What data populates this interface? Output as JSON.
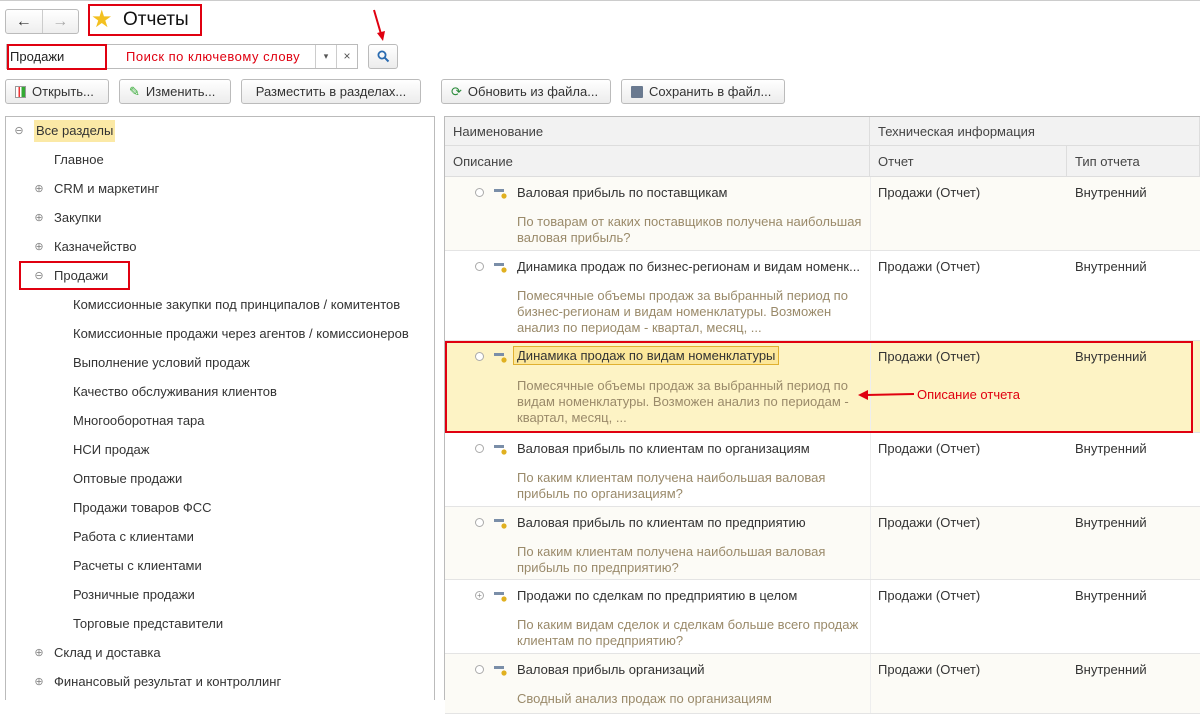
{
  "header": {
    "title": "Отчеты",
    "back": "←",
    "forward": "→"
  },
  "search": {
    "value": "Продажи",
    "hint": "Поиск по ключевому слову",
    "clear": "×"
  },
  "toolbar": {
    "open": "Открыть...",
    "edit": "Изменить...",
    "place": "Разместить в разделах...",
    "update": "Обновить из файла...",
    "save": "Сохранить в файл..."
  },
  "tree": [
    {
      "label": "Все разделы",
      "level": 0,
      "toggle": "⊖"
    },
    {
      "label": "Главное",
      "level": 1,
      "toggle": ""
    },
    {
      "label": "CRM и маркетинг",
      "level": 1,
      "toggle": "⊕"
    },
    {
      "label": "Закупки",
      "level": 1,
      "toggle": "⊕"
    },
    {
      "label": "Казначейство",
      "level": 1,
      "toggle": "⊕"
    },
    {
      "label": "Продажи",
      "level": 1,
      "toggle": "⊖"
    },
    {
      "label": "Комиссионные закупки под принципалов / комитентов",
      "level": 2,
      "toggle": ""
    },
    {
      "label": "Комиссионные продажи через агентов / комиссионеров",
      "level": 2,
      "toggle": ""
    },
    {
      "label": "Выполнение условий продаж",
      "level": 2,
      "toggle": ""
    },
    {
      "label": "Качество обслуживания клиентов",
      "level": 2,
      "toggle": ""
    },
    {
      "label": "Многооборотная тара",
      "level": 2,
      "toggle": ""
    },
    {
      "label": "НСИ продаж",
      "level": 2,
      "toggle": ""
    },
    {
      "label": "Оптовые продажи",
      "level": 2,
      "toggle": ""
    },
    {
      "label": "Продажи товаров ФСС",
      "level": 2,
      "toggle": ""
    },
    {
      "label": "Работа с клиентами",
      "level": 2,
      "toggle": ""
    },
    {
      "label": "Расчеты с клиентами",
      "level": 2,
      "toggle": ""
    },
    {
      "label": "Розничные продажи",
      "level": 2,
      "toggle": ""
    },
    {
      "label": "Торговые представители",
      "level": 2,
      "toggle": ""
    },
    {
      "label": "Склад и доставка",
      "level": 1,
      "toggle": "⊕"
    },
    {
      "label": "Финансовый результат и контроллинг",
      "level": 1,
      "toggle": "⊕"
    }
  ],
  "columns": {
    "name": "Наименование",
    "tech": "Техническая информация",
    "desc": "Описание",
    "report": "Отчет",
    "type": "Тип отчета"
  },
  "rows": [
    {
      "name": "Валовая прибыль по поставщикам",
      "desc": "По товарам от каких поставщиков получена наибольшая валовая прибыль?",
      "report": "Продажи (Отчет)",
      "type": "Внутренний",
      "toggle": ""
    },
    {
      "name": "Динамика продаж по бизнес-регионам и видам номенк...",
      "desc": "Помесячные объемы продаж за выбранный период по бизнес-регионам и видам номенклатуры. Возможен анализ по периодам - квартал, месяц, ...",
      "report": "Продажи (Отчет)",
      "type": "Внутренний",
      "toggle": ""
    },
    {
      "name": "Динамика продаж по видам номенклатуры",
      "desc": "Помесячные объемы продаж за выбранный период по видам номенклатуры. Возможен анализ по периодам - квартал, месяц, ...",
      "report": "Продажи (Отчет)",
      "type": "Внутренний",
      "toggle": "",
      "selected": true
    },
    {
      "name": "Валовая прибыль по клиентам по организациям",
      "desc": "По каким клиентам получена наибольшая валовая прибыль по организациям?",
      "report": "Продажи (Отчет)",
      "type": "Внутренний",
      "toggle": ""
    },
    {
      "name": "Валовая прибыль по клиентам по предприятию",
      "desc": "По каким клиентам получена наибольшая валовая прибыль по предприятию?",
      "report": "Продажи (Отчет)",
      "type": "Внутренний",
      "toggle": ""
    },
    {
      "name": "Продажи по сделкам по предприятию в целом",
      "desc": "По каким видам сделок и сделкам больше всего продаж клиентам по предприятию?",
      "report": "Продажи (Отчет)",
      "type": "Внутренний",
      "toggle": "+"
    },
    {
      "name": "Валовая прибыль организаций",
      "desc": "Сводный анализ продаж по организациям",
      "report": "Продажи (Отчет)",
      "type": "Внутренний",
      "toggle": ""
    }
  ],
  "annotation": {
    "label": "Описание отчета"
  },
  "colors": {
    "accent": "#e00010",
    "selected": "#fdf3c5",
    "desc": "#9a8a6a"
  }
}
